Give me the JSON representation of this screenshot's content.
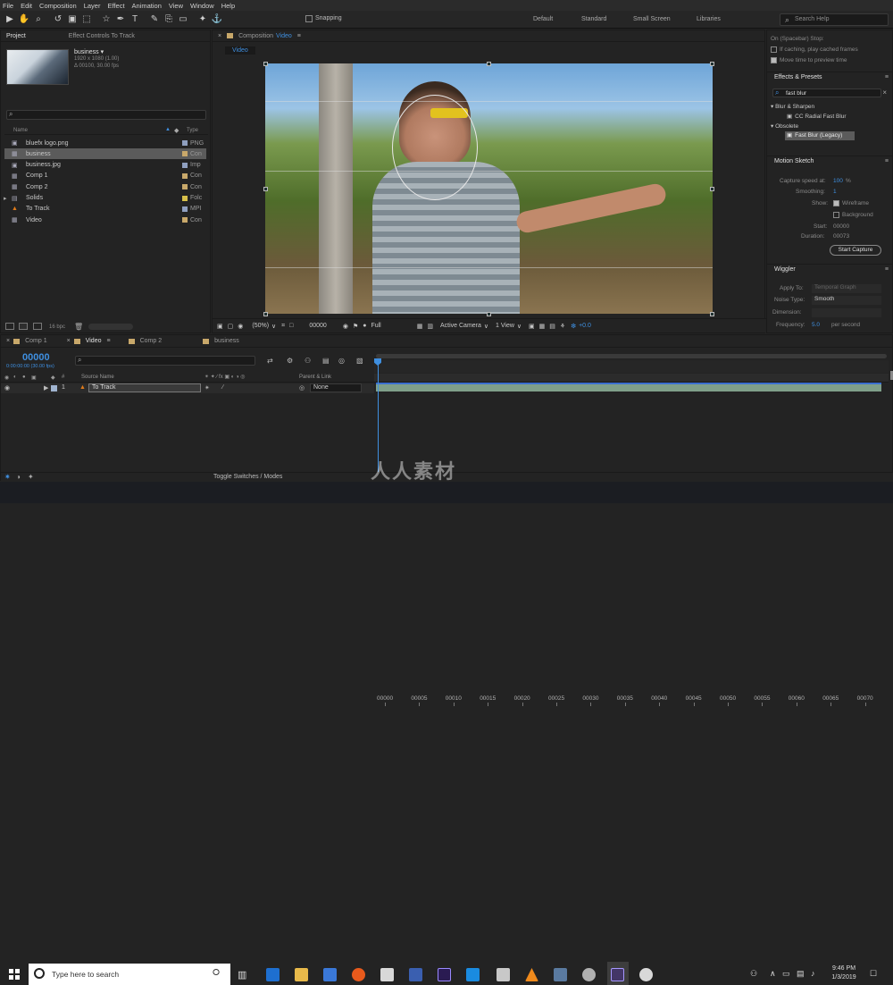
{
  "menu": [
    "File",
    "Edit",
    "Composition",
    "Layer",
    "Effect",
    "Animation",
    "View",
    "Window",
    "Help"
  ],
  "toolbar": {
    "snapping_label": "Snapping",
    "workspaces": [
      "Default",
      "Standard",
      "Small Screen",
      "Libraries"
    ],
    "search_placeholder": "Search Help"
  },
  "project": {
    "tab_project": "Project",
    "tab_effect_controls": "Effect Controls To Track",
    "item_name": "business ▾",
    "item_info1": "1920 x 1080 (1.00)",
    "item_info2": "Δ 00100, 30.00 fps",
    "col_name": "Name",
    "col_type": "Type",
    "items": [
      {
        "name": "bluefx logo.png",
        "type": "PNG",
        "color": "#8f9fbf"
      },
      {
        "name": "business",
        "type": "Con",
        "color": "#c8a86a"
      },
      {
        "name": "business.jpg",
        "type": "Imp",
        "color": "#8f9fbf"
      },
      {
        "name": "Comp 1",
        "type": "Con",
        "color": "#c8a86a"
      },
      {
        "name": "Comp 2",
        "type": "Con",
        "color": "#c8a86a"
      },
      {
        "name": "Solids",
        "type": "Folc",
        "color": "#d8c04a"
      },
      {
        "name": "To Track",
        "type": "MPI",
        "color": "#8f9fbf"
      },
      {
        "name": "Video",
        "type": "Con",
        "color": "#c8a86a"
      }
    ],
    "bpc": "16 bpc"
  },
  "composition": {
    "tab_label": "Composition",
    "tab_name": "Video",
    "subtab": "Video",
    "zoom": "(50%)",
    "timecode": "00000",
    "resolution": "Full",
    "camera": "Active Camera",
    "views": "1 View",
    "exposure": "+0.0"
  },
  "right": {
    "preview_stop": "On (Spacebar) Stop:",
    "cache_label": "If caching, play cached frames",
    "move_time_label": "Move time to preview time",
    "effects_title": "Effects & Presets",
    "effects_search": "fast blur",
    "cat1": "Blur & Sharpen",
    "cat1_item": "CC Radial Fast Blur",
    "cat2": "Obsolete",
    "cat2_item": "Fast Blur (Legacy)",
    "motion_title": "Motion Sketch",
    "capture_label": "Capture speed at:",
    "capture_val": "100",
    "capture_unit": "%",
    "smoothing_label": "Smoothing:",
    "smoothing_val": "1",
    "show_label": "Show:",
    "wireframe": "Wireframe",
    "background": "Background",
    "start_label": "Start:",
    "start_val": "00000",
    "duration_label": "Duration:",
    "duration_val": "00073",
    "capture_btn": "Start Capture",
    "wiggler_title": "Wiggler",
    "apply_label": "Apply To:",
    "apply_val": "Temporal Graph",
    "noise_label": "Noise Type:",
    "noise_val": "Smooth",
    "dim_label": "Dimension:",
    "freq_label": "Frequency:",
    "freq_val": "5.0",
    "freq_unit": "per second"
  },
  "timeline": {
    "tabs": [
      "Comp 1",
      "Video",
      "Comp 2",
      "business"
    ],
    "timecode": "00000",
    "timecode_sub": "0:00:00:00 (30.00 fps)",
    "col_source": "Source Name",
    "col_parent": "Parent & Link",
    "layer_num": "1",
    "layer_name": "To Track",
    "parent_val": "None",
    "ticks": [
      "00000",
      "00005",
      "00010",
      "00015",
      "00020",
      "00025",
      "00030",
      "00035",
      "00040",
      "00045",
      "00050",
      "00055",
      "00060",
      "00065",
      "00070"
    ],
    "toggle_label": "Toggle Switches / Modes"
  },
  "taskbar": {
    "search_placeholder": "Type here to search",
    "time": "9:46 PM",
    "date": "1/3/2019"
  },
  "watermark": "人人素材"
}
